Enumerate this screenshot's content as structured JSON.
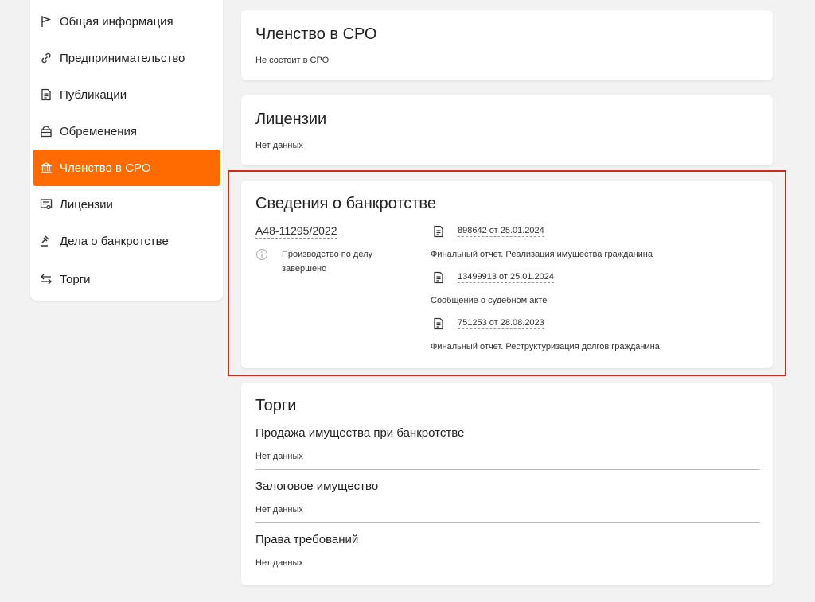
{
  "sidebar": {
    "items": [
      {
        "label": "Общая информация",
        "icon": "flag-icon",
        "active": false
      },
      {
        "label": "Предпринимательство",
        "icon": "link-icon",
        "active": false
      },
      {
        "label": "Публикации",
        "icon": "document-icon",
        "active": false
      },
      {
        "label": "Обременения",
        "icon": "lock-box-icon",
        "active": false
      },
      {
        "label": "Членство в СРО",
        "icon": "building-icon",
        "active": true
      },
      {
        "label": "Лицензии",
        "icon": "license-icon",
        "active": false
      },
      {
        "label": "Дела о банкротстве",
        "icon": "gavel-icon",
        "active": false
      },
      {
        "label": "Торги",
        "icon": "swap-arrows-icon",
        "active": false
      }
    ]
  },
  "sro": {
    "title": "Членство в СРО",
    "status": "Не состоит в СРО"
  },
  "licenses": {
    "title": "Лицензии",
    "status": "Нет данных"
  },
  "bankruptcy": {
    "title": "Сведения о банкротстве",
    "case_number": "А48-11295/2022",
    "case_status": "Производство по делу завершено",
    "documents": [
      {
        "link": "898642 от 25.01.2024",
        "description": "Финальный отчет. Реализация имущества гражданина"
      },
      {
        "link": "13499913 от 25.01.2024",
        "description": "Сообщение о судебном акте"
      },
      {
        "link": "751253 от 28.08.2023",
        "description": "Финальный отчет. Реструктуризация долгов гражданина"
      }
    ]
  },
  "trades": {
    "title": "Торги",
    "sections": [
      {
        "title": "Продажа имущества при банкротстве",
        "status": "Нет данных"
      },
      {
        "title": "Залоговое имущество",
        "status": "Нет данных"
      },
      {
        "title": "Права требований",
        "status": "Нет данных"
      }
    ]
  },
  "colors": {
    "accent": "#ff6b00",
    "highlight": "#c62f21",
    "background": "#f2f2f2"
  }
}
